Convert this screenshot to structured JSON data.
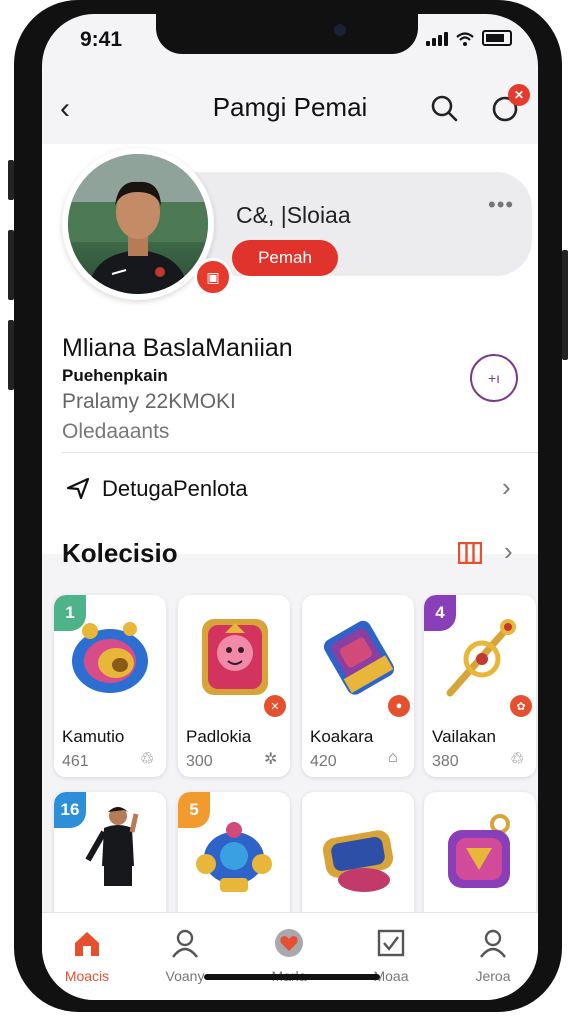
{
  "status": {
    "time": "9:41"
  },
  "topbar": {
    "title": "Pamgi Pemai",
    "notification_count": ""
  },
  "profile": {
    "handle": "C&, |Sloiaa",
    "role": "Pemah",
    "full_name": "Mliana BaslaManiian",
    "subtitle": "Puehenpkain",
    "stat": "Pralamy 22KMOKI",
    "location": "Oledaaants",
    "details_label": "DetugaPenlota"
  },
  "collection": {
    "title": "Kolecisio",
    "cards": [
      {
        "tag": "1",
        "name": "Kamutio",
        "count": "461"
      },
      {
        "tag": "",
        "name": "Padlokia",
        "count": "300"
      },
      {
        "tag": "",
        "name": "Koakara",
        "count": "420"
      },
      {
        "tag": "4",
        "name": "Vailakan",
        "count": "380"
      },
      {
        "tag": "16",
        "name": "",
        "count": ""
      },
      {
        "tag": "5",
        "name": "",
        "count": ""
      },
      {
        "tag": "",
        "name": "",
        "count": ""
      },
      {
        "tag": "",
        "name": "",
        "count": ""
      }
    ]
  },
  "tabs": [
    {
      "label": "Moacis",
      "icon": "home-icon"
    },
    {
      "label": "Voany",
      "icon": "user-icon"
    },
    {
      "label": "Marla",
      "icon": "heart-icon"
    },
    {
      "label": "Moaa",
      "icon": "checkbox-icon"
    },
    {
      "label": "Jeroa",
      "icon": "profile-icon"
    }
  ],
  "colors": {
    "accent": "#e5502f",
    "role_button": "#e0332c",
    "add_button": "#7a3a8c"
  }
}
